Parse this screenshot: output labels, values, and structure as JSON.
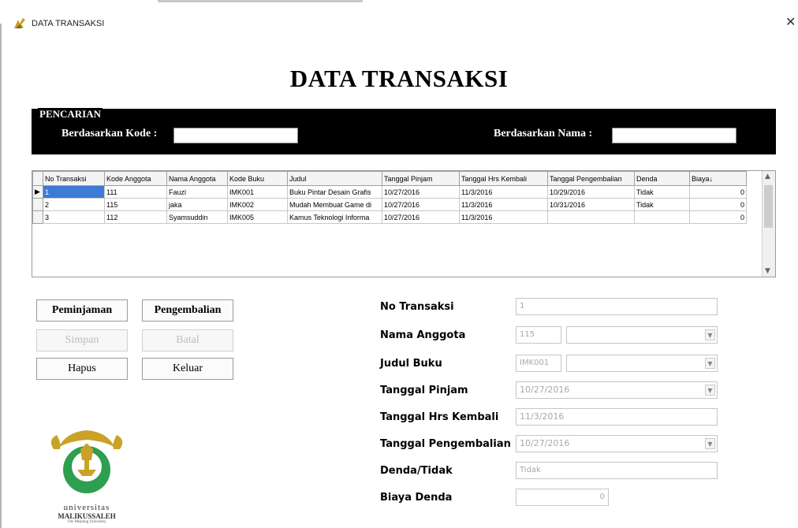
{
  "window": {
    "title": "DATA TRANSAKSI",
    "close_glyph": "✕"
  },
  "heading": "DATA TRANSAKSI",
  "search": {
    "legend": "PENCARIAN",
    "by_code_label": "Berdasarkan Kode :",
    "by_code_value": "",
    "by_name_label": "Berdasarkan Nama :",
    "by_name_value": ""
  },
  "grid": {
    "columns": [
      "No Transaksi",
      "Kode Anggota",
      "Nama Anggota",
      "Kode Buku",
      "Judul",
      "Tanggal Pinjam",
      "Tanggal Hrs Kembali",
      "Tanggal Pengembalian",
      "Denda",
      "Biaya↓"
    ],
    "rows": [
      [
        "1",
        "111",
        "Fauzi",
        "IMK001",
        "Buku Pintar Desain Grafis",
        "10/27/2016",
        "11/3/2016",
        "10/29/2016",
        "Tidak",
        "0"
      ],
      [
        "2",
        "115",
        "jaka",
        "IMK002",
        "Mudah Membuat Game di",
        "10/27/2016",
        "11/3/2016",
        "10/31/2016",
        "Tidak",
        "0"
      ],
      [
        "3",
        "112",
        "Syamsuddin",
        "IMK005",
        "Kamus Teknologi Informa",
        "10/27/2016",
        "11/3/2016",
        "",
        "",
        "0"
      ]
    ],
    "selected_row": 0
  },
  "buttons": {
    "peminjaman": "Peminjaman",
    "pengembalian": "Pengembalian",
    "simpan": "Simpan",
    "batal": "Batal",
    "hapus": "Hapus",
    "keluar": "Keluar"
  },
  "form": {
    "no_transaksi": {
      "label": "No Transaksi",
      "value": "1"
    },
    "nama_anggota": {
      "label": "Nama Anggota",
      "code": "115",
      "value": ""
    },
    "judul_buku": {
      "label": "Judul Buku",
      "code": "IMK001",
      "value": ""
    },
    "tanggal_pinjam": {
      "label": "Tanggal Pinjam",
      "value": "10/27/2016"
    },
    "tanggal_hrs_kembali": {
      "label": "Tanggal Hrs Kembali",
      "value": "11/3/2016"
    },
    "tanggal_pengembalian": {
      "label": "Tanggal Pengembalian",
      "value": "10/27/2016"
    },
    "denda": {
      "label": "Denda/Tidak",
      "value": "Tidak"
    },
    "biaya_denda": {
      "label": "Biaya Denda",
      "value": "0"
    }
  },
  "logo": {
    "line1": "universitas",
    "line2": "MALIKUSSALEH",
    "line3": "The Meaning University",
    "colors": {
      "gold": "#c9a227",
      "green": "#2e9e4f"
    }
  },
  "colors": {
    "selection": "#3d7bd6",
    "panel": "#000000"
  }
}
